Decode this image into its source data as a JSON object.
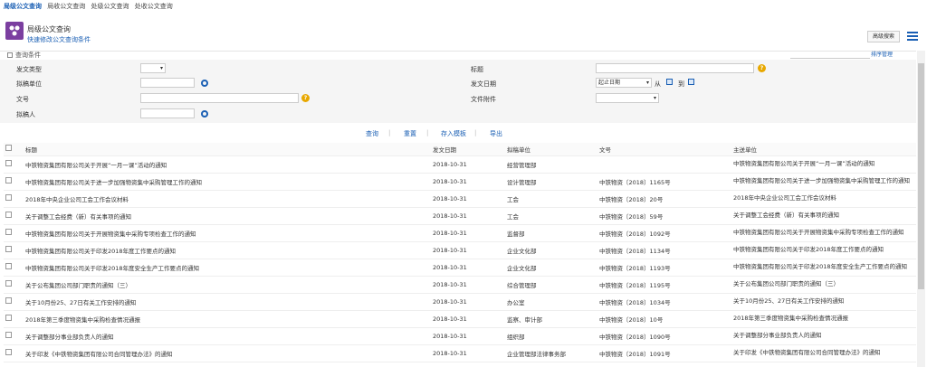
{
  "breadcrumb": [
    "局级公文查询",
    "局收公文查询",
    "处级公文查询",
    "处收公文查询"
  ],
  "app": {
    "title": "局级公文查询",
    "subtitle": "快速修改公文查询条件"
  },
  "toolbar": {
    "advanced": "高级搜索",
    "sort_link": "排序管理"
  },
  "conditions": {
    "title": "查询条件",
    "doc_type_label": "发文类型",
    "dept_label": "拟稿单位",
    "docno_label": "文号",
    "drafter_label": "拟稿人",
    "title_label": "标题",
    "date_label": "发文日期",
    "date_mode": "起止日期",
    "date_from": "从",
    "date_to": "到",
    "attach_label": "文件附件"
  },
  "actions": {
    "query": "查询",
    "reset": "重置",
    "save_template": "存入模板",
    "export": "导出"
  },
  "table": {
    "headers": [
      "标题",
      "发文日期",
      "拟稿单位",
      "文号",
      "主送单位"
    ],
    "rows": [
      [
        "中铁物资集团有限公司关于开展“一月一课”活动的通知",
        "2018-10-31",
        "经营管理部",
        "",
        "中铁物资集团有限公司关于开展“一月一课”活动的通知"
      ],
      [
        "中铁物资集团有限公司关于进一步加强物资集中采购管理工作的通知",
        "2018-10-31",
        "设计管理部",
        "中铁物资〔2018〕1165号",
        "中铁物资集团有限公司关于进一步加强物资集中采购管理工作的通知"
      ],
      [
        "2018年中央企业公司工会工作会议材料",
        "2018-10-31",
        "工会",
        "中铁物资〔2018〕20号",
        "2018年中央企业公司工会工作会议材料"
      ],
      [
        "关于调整工会经费（新）有关事项的通知",
        "2018-10-31",
        "工会",
        "中铁物资〔2018〕59号",
        "关于调整工会经费（新）有关事项的通知"
      ],
      [
        "中铁物资集团有限公司关于开展物资集中采购专项检查工作的通知",
        "2018-10-31",
        "监督部",
        "中铁物资〔2018〕1092号",
        "中铁物资集团有限公司关于开展物资集中采购专项检查工作的通知"
      ],
      [
        "中铁物资集团有限公司关于印发2018年度工作要点的通知",
        "2018-10-31",
        "企业文化部",
        "中铁物资〔2018〕1134号",
        "中铁物资集团有限公司关于印发2018年度工作要点的通知"
      ],
      [
        "中铁物资集团有限公司关于印发2018年度安全生产工作要点的通知",
        "2018-10-31",
        "企业文化部",
        "中铁物资〔2018〕1193号",
        "中铁物资集团有限公司关于印发2018年度安全生产工作要点的通知"
      ],
      [
        "关于公布集团公司部门职责的通知（三）",
        "2018-10-31",
        "综合管理部",
        "中铁物资〔2018〕1195号",
        "关于公布集团公司部门职责的通知（三）"
      ],
      [
        "关于10月份25、27日有关工作安排的通知",
        "2018-10-31",
        "办公室",
        "中铁物资〔2018〕1034号",
        "关于10月份25、27日有关工作安排的通知"
      ],
      [
        "2018年第三季度物资集中采购检查情况通报",
        "2018-10-31",
        "监察、审计部",
        "中铁物资〔2018〕10号",
        "2018年第三季度物资集中采购检查情况通报"
      ],
      [
        "关于调整部分事业部负责人的通知",
        "2018-10-31",
        "组织部",
        "中铁物资〔2018〕1090号",
        "关于调整部分事业部负责人的通知"
      ],
      [
        "关于印发《中铁物资集团有限公司合同管理办法》的通知",
        "2018-10-31",
        "企业管理部法律事务部",
        "中铁物资〔2018〕1091号",
        "关于印发《中铁物资集团有限公司合同管理办法》的通知"
      ]
    ]
  }
}
